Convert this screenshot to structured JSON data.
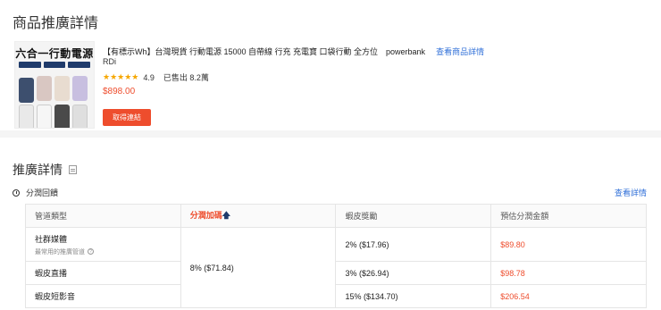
{
  "section1": {
    "title": "商品推廣詳情"
  },
  "product": {
    "thumb_heading": "六合一行動電源",
    "title": "【有標示Wh】台灣現貨 行動電源 15000 自帶線 行充 充電寶 口袋行動 全方位　powerbank",
    "view_link": "查看商品詳情",
    "brand": "RDi",
    "stars": "★★★★★",
    "rating": "4.9",
    "sold": "已售出 8.2萬",
    "price": "$898.00",
    "get_link_button": "取得連結"
  },
  "section2": {
    "title": "推廣詳情",
    "subtitle": "分潤回饋",
    "view_link": "查看詳情"
  },
  "table": {
    "headers": [
      "管道類型",
      "分潤加碼",
      "蝦皮獎勵",
      "預估分潤金額"
    ],
    "header_up_icon": "🡅",
    "merged_bonus": "8% ($71.84)",
    "rows": [
      {
        "channel": "社群媒體",
        "hint": "最常用的推廣管道",
        "reward": "2% ($17.96)",
        "amount": "$89.80"
      },
      {
        "channel": "蝦皮直播",
        "reward": "3% ($26.94)",
        "amount": "$98.78"
      },
      {
        "channel": "蝦皮短影音",
        "reward": "15% ($134.70)",
        "amount": "$206.54"
      }
    ]
  },
  "colors": {
    "accent": "#ee4d2d",
    "link": "#2f6fd8",
    "star": "#f6a700"
  }
}
